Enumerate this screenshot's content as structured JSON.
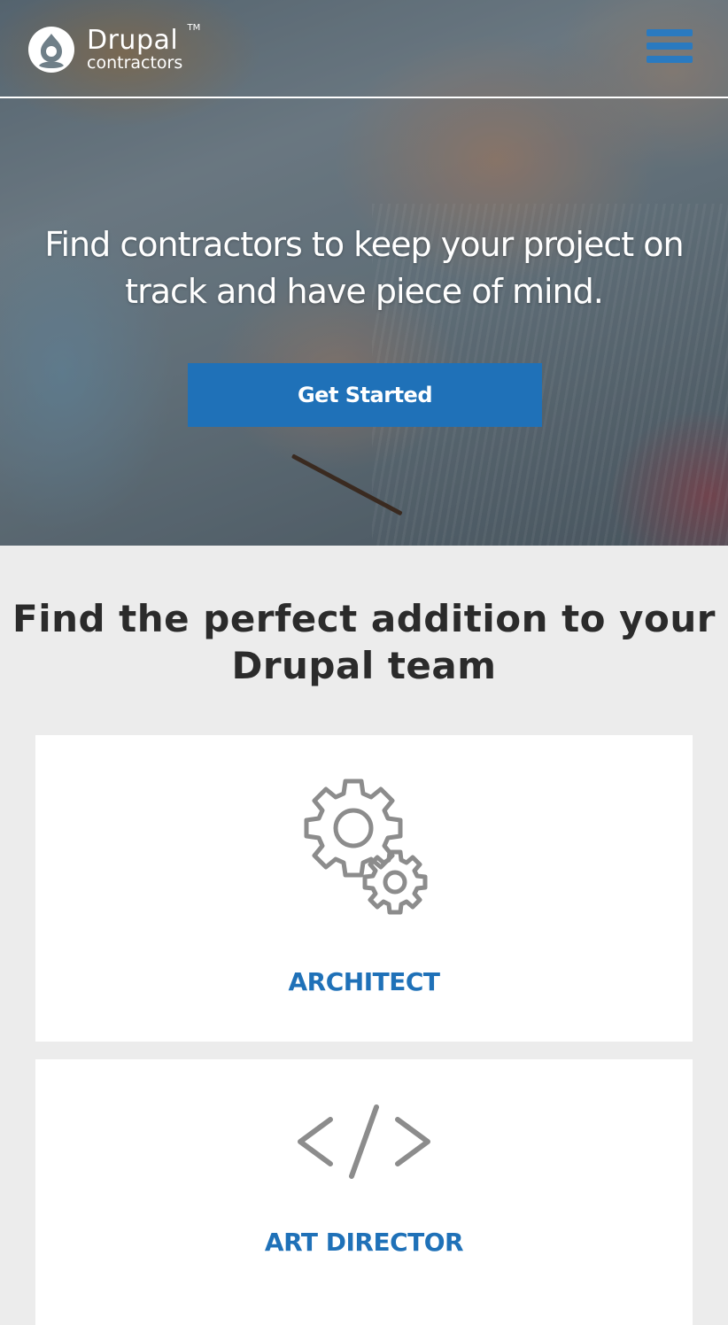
{
  "header": {
    "logo": {
      "name": "Drupal",
      "subtitle": "contractors",
      "trademark": "TM"
    },
    "menu_icon": "hamburger-menu-icon"
  },
  "hero": {
    "title": "Find contractors to keep your project on track and have piece of mind.",
    "cta_label": "Get Started"
  },
  "section": {
    "title": "Find the perfect addition to your Drupal team",
    "cards": [
      {
        "label": "ARCHITECT",
        "icon": "gears-icon"
      },
      {
        "label": "ART DIRECTOR",
        "icon": "code-icon"
      }
    ]
  },
  "colors": {
    "accent": "#1f71b8",
    "menu": "#2a7ac0",
    "page_background": "#ececec",
    "card_background": "#ffffff",
    "heading_text": "#2b2b2b",
    "icon_gray": "#8c8c8c"
  }
}
